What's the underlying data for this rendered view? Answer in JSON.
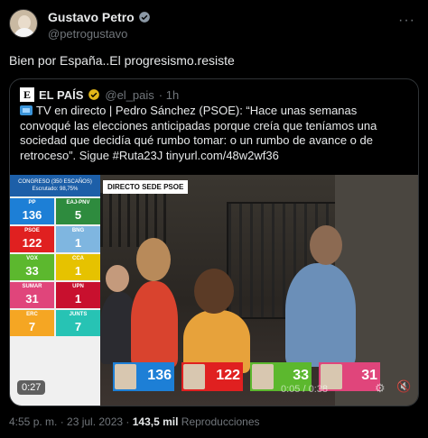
{
  "author": {
    "name": "Gustavo Petro",
    "handle": "@petrogustavo"
  },
  "tweet": {
    "text": "Bien por España..El progresismo.resiste"
  },
  "quote": {
    "source_name": "EL PAÍS",
    "logo_letter": "E",
    "source_handle": "@el_pais",
    "time": "· 1h",
    "text": "TV en directo | Pedro Sánchez (PSOE): “Hace unas semanas convoqué las elecciones anticipadas porque creía que teníamos una sociedad que decidía qué rumbo tomar: o un rumbo de avance o de retroceso”. Sigue #Ruta23J tinyurl.com/48w2wf36"
  },
  "video": {
    "live_label": "DIRECTO SEDE PSOE",
    "scoreboard_title": "CONGRESO (350 ESCAÑOS)",
    "scoreboard_sub": "Escrutado: 98,75%",
    "parties": [
      {
        "label": "PP",
        "value": "136",
        "color": "#1d7fd6"
      },
      {
        "label": "EAJ-PNV",
        "value": "5",
        "color": "#2e8b3e"
      },
      {
        "label": "PSOE",
        "value": "122",
        "color": "#e02020"
      },
      {
        "label": "BNG",
        "value": "1",
        "color": "#7fb6e0"
      },
      {
        "label": "VOX",
        "value": "33",
        "color": "#5cb82e"
      },
      {
        "label": "CCA",
        "value": "1",
        "color": "#e6c200"
      },
      {
        "label": "SUMAR",
        "value": "31",
        "color": "#e0457b"
      },
      {
        "label": "UPN",
        "value": "1",
        "color": "#c8102e"
      },
      {
        "label": "ERC",
        "value": "7",
        "color": "#f5a623"
      },
      {
        "label": "JUNTS",
        "value": "7",
        "color": "#27c3b4"
      }
    ],
    "bottom_scores": [
      {
        "value": "136",
        "color": "#1d7fd6"
      },
      {
        "value": "122",
        "color": "#e02020"
      },
      {
        "value": "33",
        "color": "#5cb82e"
      },
      {
        "value": "31",
        "color": "#e0457b"
      }
    ],
    "elapsed": "0:27",
    "progress": "0:05 / 0:38"
  },
  "footer": {
    "datetime": "4:55 p. m. · 23 jul. 2023 ·",
    "views_count": "143,5 mil",
    "views_label": "Reproducciones"
  }
}
